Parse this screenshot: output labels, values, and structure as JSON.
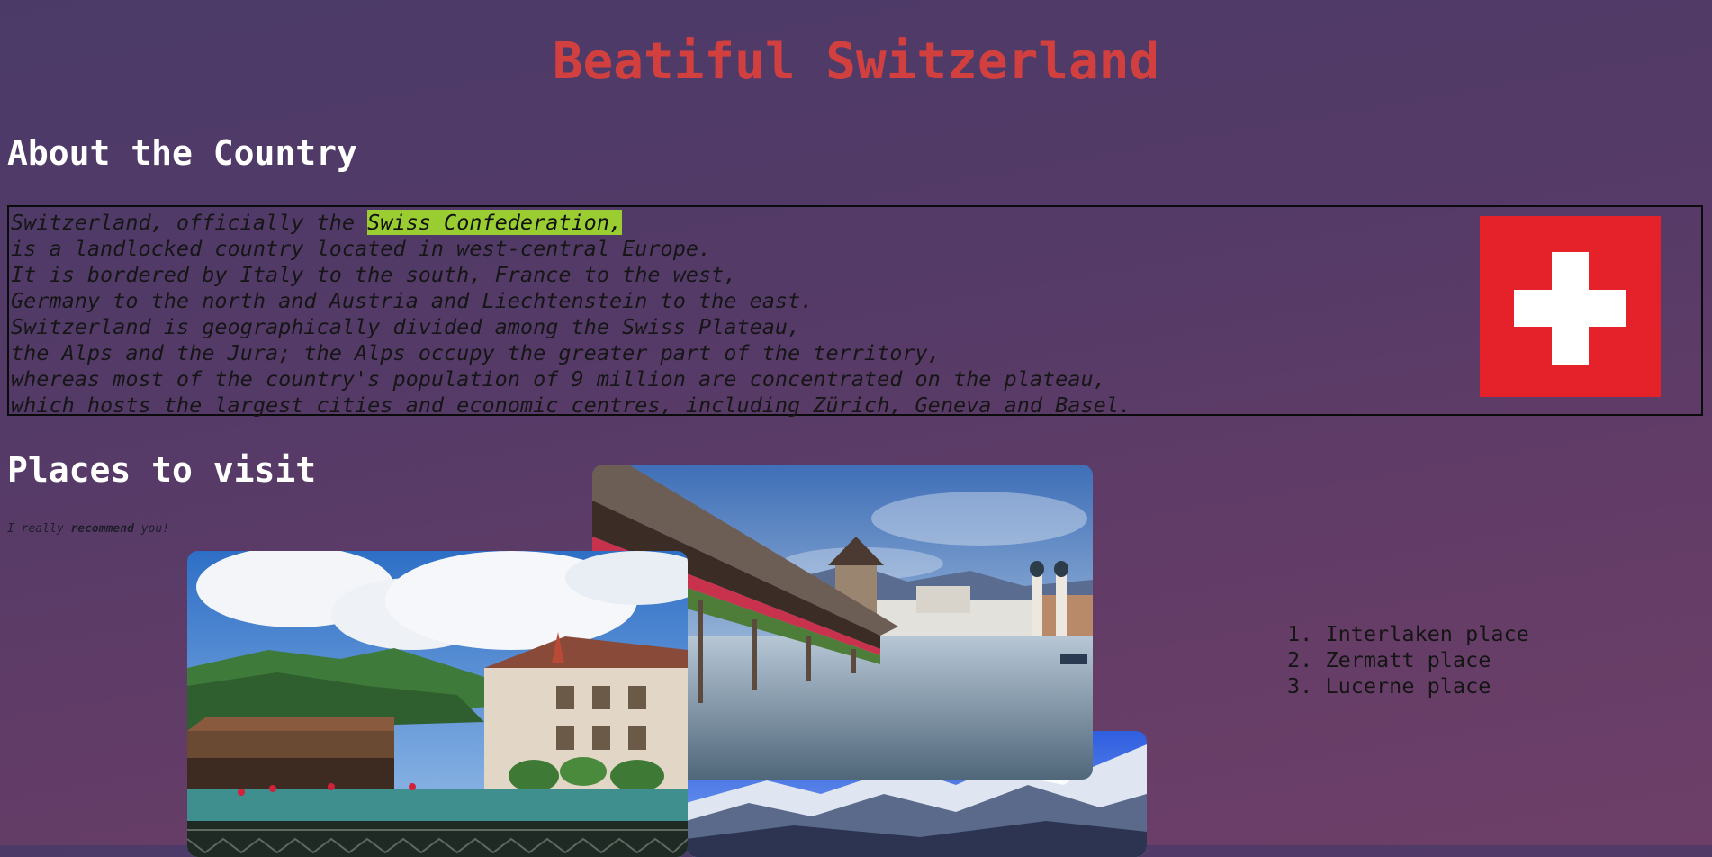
{
  "header": {
    "title": "Beatiful Switzerland"
  },
  "about": {
    "heading": "About the Country",
    "lead": "Switzerland, officially the ",
    "highlight": "Swiss Confederation,",
    "lines": [
      "is a landlocked country located in west-central Europe.",
      "It is bordered by Italy to the south, France to the west,",
      "Germany to the north and Austria and Liechtenstein to the east.",
      "Switzerland is geographically divided among the Swiss Plateau,",
      "the Alps and the Jura; the Alps occupy the greater part of the territory,",
      "whereas most of the country's population of 9 million are concentrated on the plateau,",
      "which hosts the largest cities and economic centres, including Zürich, Geneva and Basel."
    ],
    "flag": {
      "icon": "swiss-flag",
      "color": "#e52229",
      "cross_color": "#ffffff"
    }
  },
  "places": {
    "heading": "Places to visit",
    "note_prefix": "I really ",
    "note_bold": "recommend",
    "note_suffix": " you!",
    "list": [
      "1. Interlaken place",
      "2. Zermatt place",
      "3. Lucerne place"
    ]
  },
  "colors": {
    "title": "#d23f3f",
    "highlight": "#9acd32",
    "heading": "#ffffff"
  }
}
